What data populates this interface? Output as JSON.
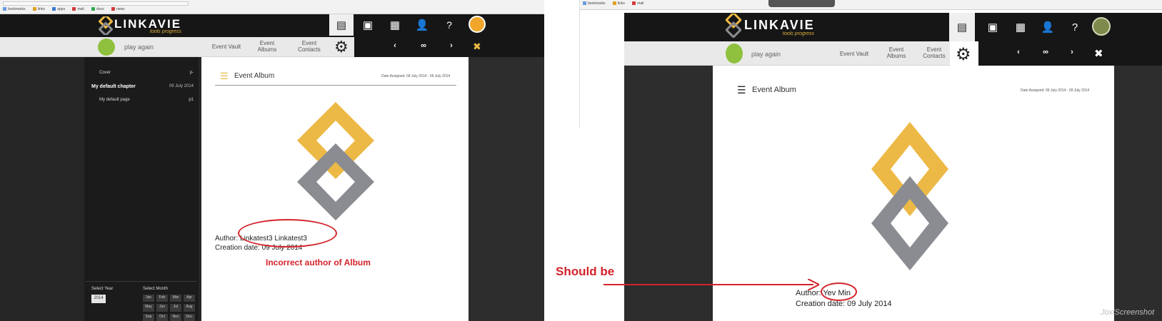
{
  "left": {
    "brand": {
      "logo": "LINKAVIE",
      "tagline": "tools progress"
    },
    "subbar": {
      "play_again": "play again",
      "nav": [
        "Event Vault",
        "Event Albums",
        "Event Contacts"
      ]
    },
    "pager": [
      "‹",
      "∞",
      "›"
    ],
    "sidebar": {
      "toc": [
        {
          "label": "Cover",
          "page": "p-",
          "bold": false
        },
        {
          "label": "My default chapter",
          "page": "09 July 2014",
          "bold": true
        },
        {
          "label": "My default page",
          "page": "p1",
          "bold": false
        }
      ],
      "select_year_label": "Select Year",
      "select_month_label": "Select Month",
      "year": "2014",
      "months": [
        "Jan",
        "Feb",
        "Mar",
        "Apr",
        "May",
        "Jun",
        "Jul",
        "Aug",
        "Sep",
        "Oct",
        "Nov",
        "Dec"
      ]
    },
    "content": {
      "title": "Event Album",
      "date_range": "Date Assigned: 09 July 2014 - 09 July 2014",
      "author_label": "Author:",
      "author_value": "Linkatest3 Linkatest3",
      "creation_label": "Creation date:",
      "creation_value": "09 July 2014"
    },
    "annotation": "Incorrect author of Album"
  },
  "right": {
    "brand": {
      "logo": "LINKAVIE",
      "tagline": "tools progress"
    },
    "subbar": {
      "play_again": "play again",
      "nav": [
        "Event Vault",
        "Event Albums",
        "Event Contacts"
      ]
    },
    "pager": [
      "‹",
      "∞",
      "›"
    ],
    "content": {
      "title": "Event Album",
      "date_range": "Date Assigned: 09 July 2014 - 09 July 2014",
      "author_label": "Author:",
      "author_value": "Yev Min",
      "creation_label": "Creation date:",
      "creation_value": "09 July 2014"
    },
    "annotation": "Should be"
  },
  "watermark": "JoxiScreenshot",
  "colors": {
    "accent_gold": "#EDB946",
    "logo_gray": "#8A8C92",
    "annotation_red": "#D2232A",
    "header_dark": "#161616"
  }
}
